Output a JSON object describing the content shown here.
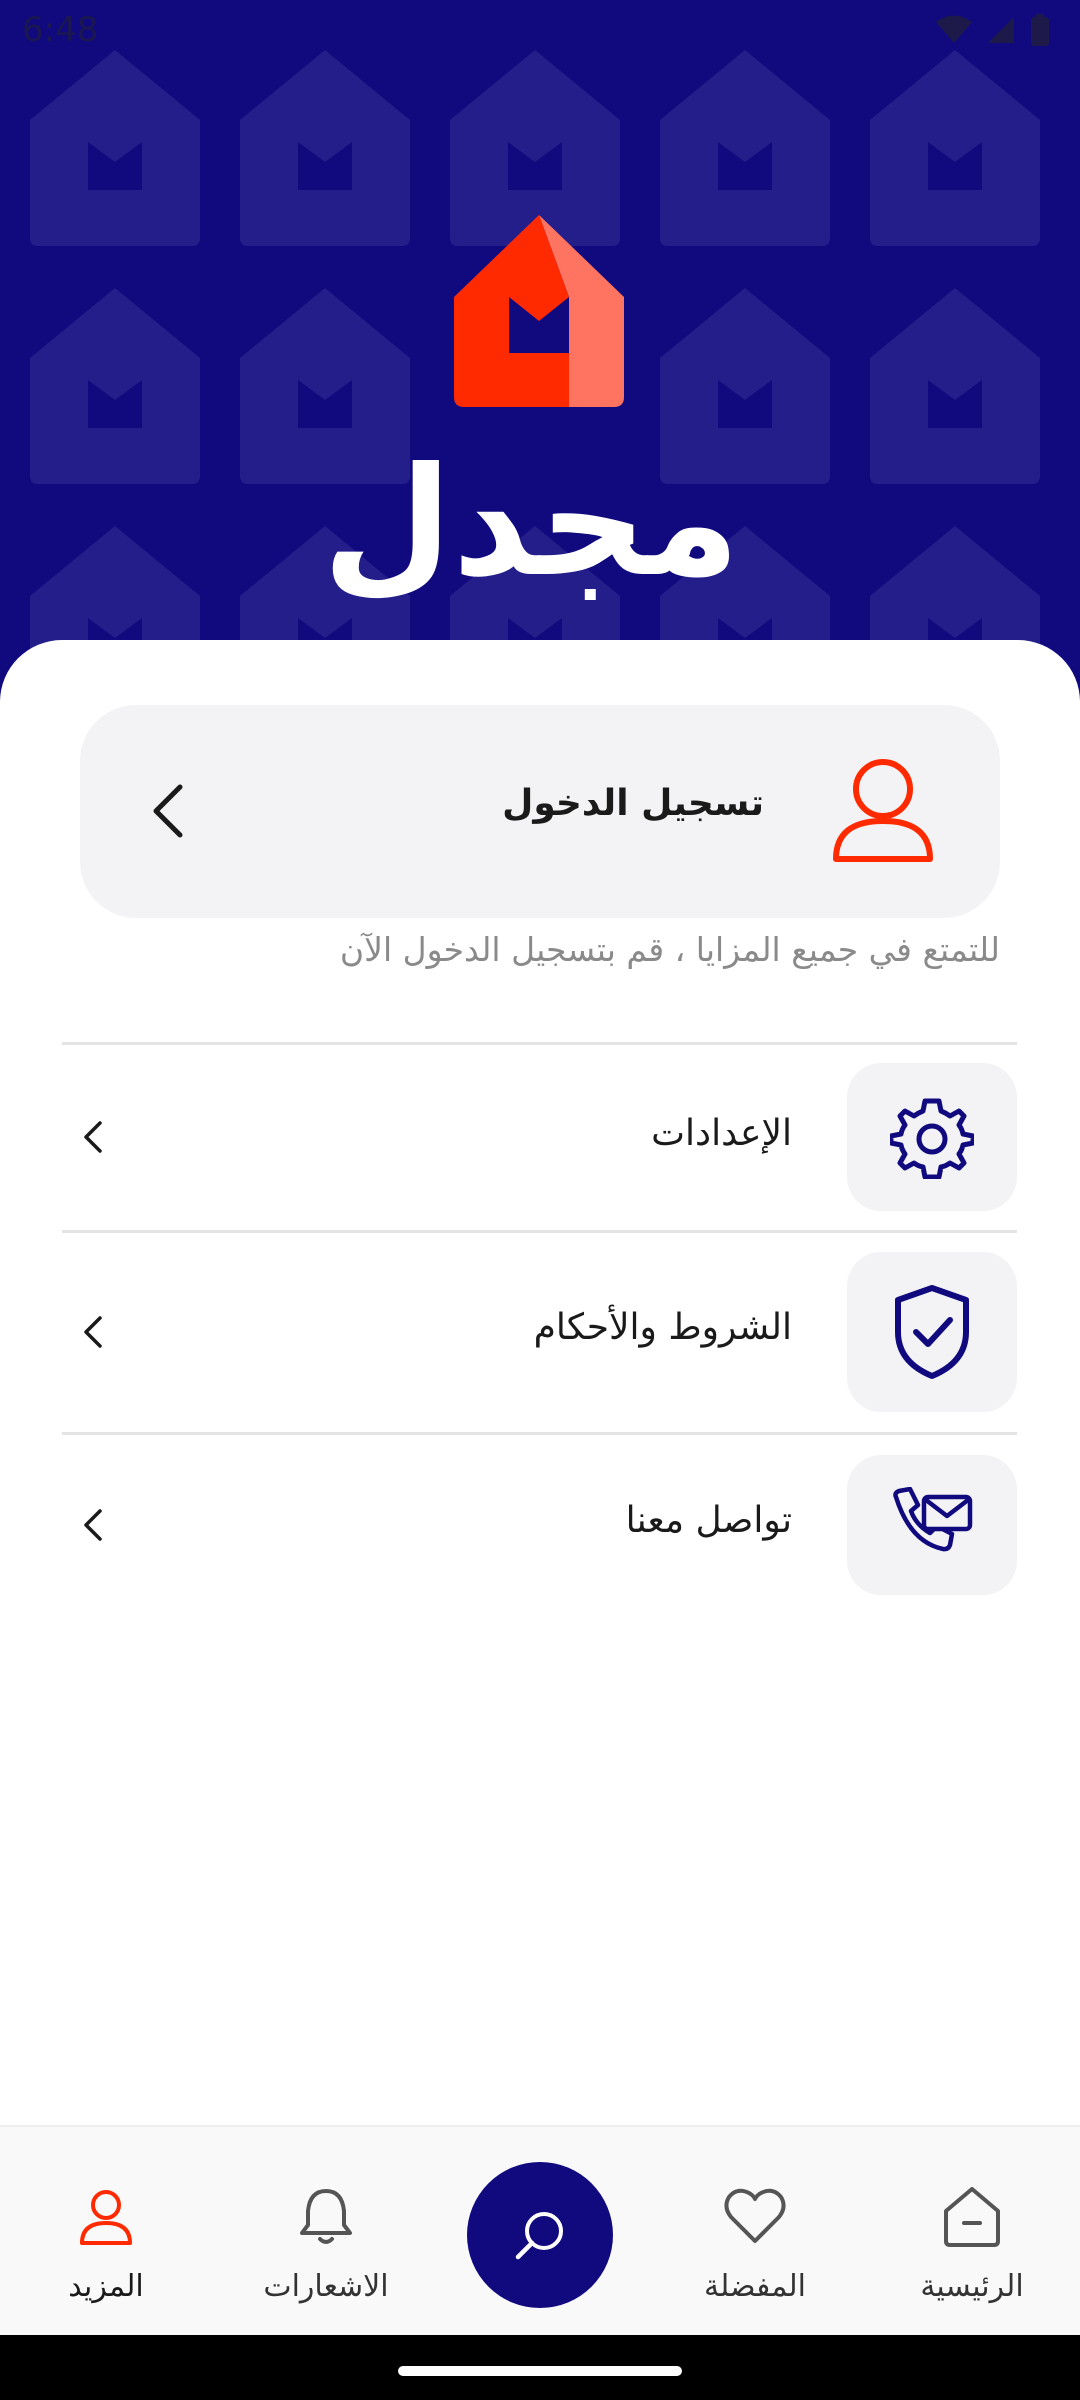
{
  "status_bar": {
    "time": "6:48"
  },
  "brand": {
    "name": "مجدل"
  },
  "login": {
    "label": "تسجيل الدخول",
    "hint": "للتمتع في جميع المزايا ، قم بتسجيل الدخول الآن"
  },
  "menu": {
    "items": [
      {
        "label": "الإعدادات",
        "icon": "gear-icon"
      },
      {
        "label": "الشروط والأحكام",
        "icon": "shield-check-icon"
      },
      {
        "label": "تواصل معنا",
        "icon": "phone-mail-icon"
      }
    ]
  },
  "nav": {
    "items": [
      {
        "label": "الرئيسية",
        "icon": "home-icon"
      },
      {
        "label": "المفضلة",
        "icon": "heart-icon"
      },
      {
        "label": "",
        "icon": "search-icon"
      },
      {
        "label": "الاشعارات",
        "icon": "bell-icon"
      },
      {
        "label": "المزيد",
        "icon": "user-icon"
      }
    ],
    "active": "المزيد"
  },
  "colors": {
    "brand_navy": "#100A7E",
    "brand_red": "#FF2A00",
    "brand_coral": "#FF7461",
    "card_bg": "#F3F3F5",
    "hint_text": "#8A8A8A"
  }
}
